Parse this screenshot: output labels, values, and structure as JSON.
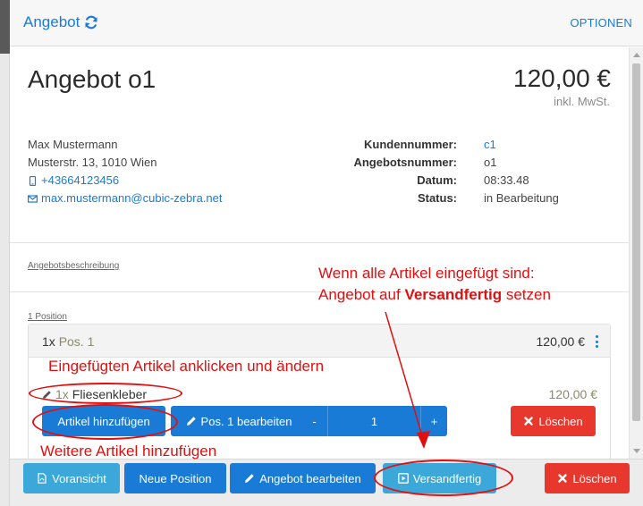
{
  "topbar": {
    "title": "Angebot",
    "options": "OPTIONEN"
  },
  "quote": {
    "title": "Angebot o1",
    "total": "120,00 €",
    "vat_note": "inkl. MwSt."
  },
  "customer": {
    "name": "Max Mustermann",
    "address": "Musterstr. 13, 1010 Wien",
    "phone": "+43664123456",
    "email": "max.mustermann@cubic-zebra.net"
  },
  "meta": {
    "labels": [
      "Kundennummer:",
      "Angebotsnummer:",
      "Datum:",
      "Status:"
    ],
    "values": [
      "c1",
      "o1",
      "08:33.48",
      "in Bearbeitung"
    ]
  },
  "sections": {
    "description_link": "Angebotsbeschreibung",
    "positions_link": "1 Position"
  },
  "position": {
    "qty": "1x",
    "name": "Pos. 1",
    "price": "120,00 €",
    "item_qty": "1x",
    "item_name": "Fliesenkleber",
    "item_price": "120,00 €"
  },
  "position_buttons": {
    "add_item": "Artikel hinzufügen",
    "edit_pos": "Pos. 1 bearbeiten",
    "minus": "-",
    "qty_value": "1",
    "plus": "+",
    "delete": "Löschen"
  },
  "footer_buttons": {
    "preview": "Voransicht",
    "new_position": "Neue Position",
    "edit_quote": "Angebot bearbeiten",
    "ready_to_ship": "Versandfertig",
    "delete": "Löschen"
  },
  "annotations": {
    "top_line1": "Wenn alle Artikel eingefügt sind:",
    "top_line2_prefix": "Angebot auf",
    "top_line2_bold": "Versandfertig",
    "top_line2_suffix": "setzen",
    "click_item": "Eingefügten Artikel anklicken und ändern",
    "add_more": "Weitere Artikel hinzufügen"
  },
  "colors": {
    "primary": "#1a7bd6",
    "danger": "#e8382e",
    "info": "#3ba8d9",
    "annotation": "#e01010"
  }
}
